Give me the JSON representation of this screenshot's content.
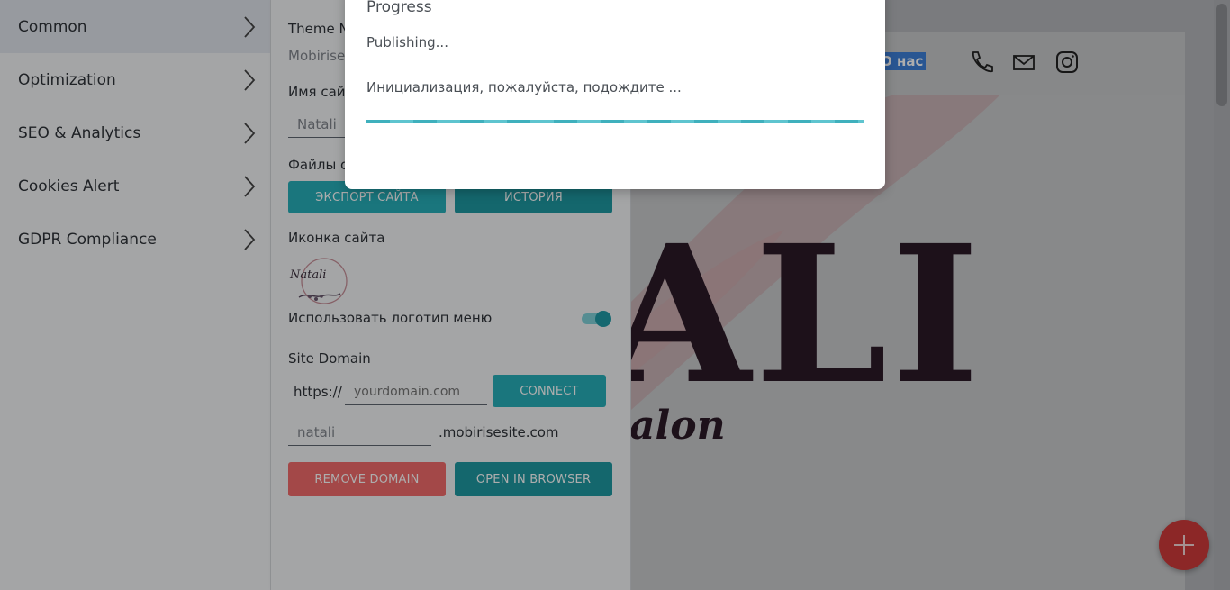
{
  "sidebar": {
    "items": [
      {
        "label": "Common",
        "active": true
      },
      {
        "label": "Optimization",
        "active": false
      },
      {
        "label": "SEO & Analytics",
        "active": false
      },
      {
        "label": "Cookies Alert",
        "active": false
      },
      {
        "label": "GDPR Compliance",
        "active": false
      }
    ]
  },
  "panel": {
    "theme_label": "Theme N",
    "theme_value": "Mobirise",
    "site_name_label": "Имя сайт",
    "site_name_value": "Natali",
    "files_label": "Файлы с",
    "export_button": "ЭКСПОРТ САЙТА",
    "history_button": "ИСТОРИЯ",
    "favicon_label": "Иконка сайта",
    "favicon_logo_text": "Natali",
    "use_logo_label": "Использовать логотип меню",
    "use_logo_enabled": true,
    "site_domain_label": "Site Domain",
    "https_prefix": "https://",
    "domain_placeholder": "yourdomain.com",
    "connect_button": "CONNECT",
    "subdomain_value": "natali",
    "subdomain_suffix": ".mobirisesite.com",
    "remove_domain_button": "REMOVE DOMAIN",
    "open_browser_button": "OPEN IN BROWSER"
  },
  "preview": {
    "nav_link": "О нас",
    "hero_text": "ALI",
    "hero_script": "alon",
    "header_icons": [
      "phone-icon",
      "mail-icon",
      "instagram-icon"
    ]
  },
  "modal": {
    "title": "Progress",
    "status": "Publishing...",
    "message": "Инициализация, пожалуйста, подождите ...",
    "progress": 1.0
  },
  "colors": {
    "accent": "#27aeb8",
    "danger": "#f06a6a",
    "fab": "#ce3a3a"
  }
}
